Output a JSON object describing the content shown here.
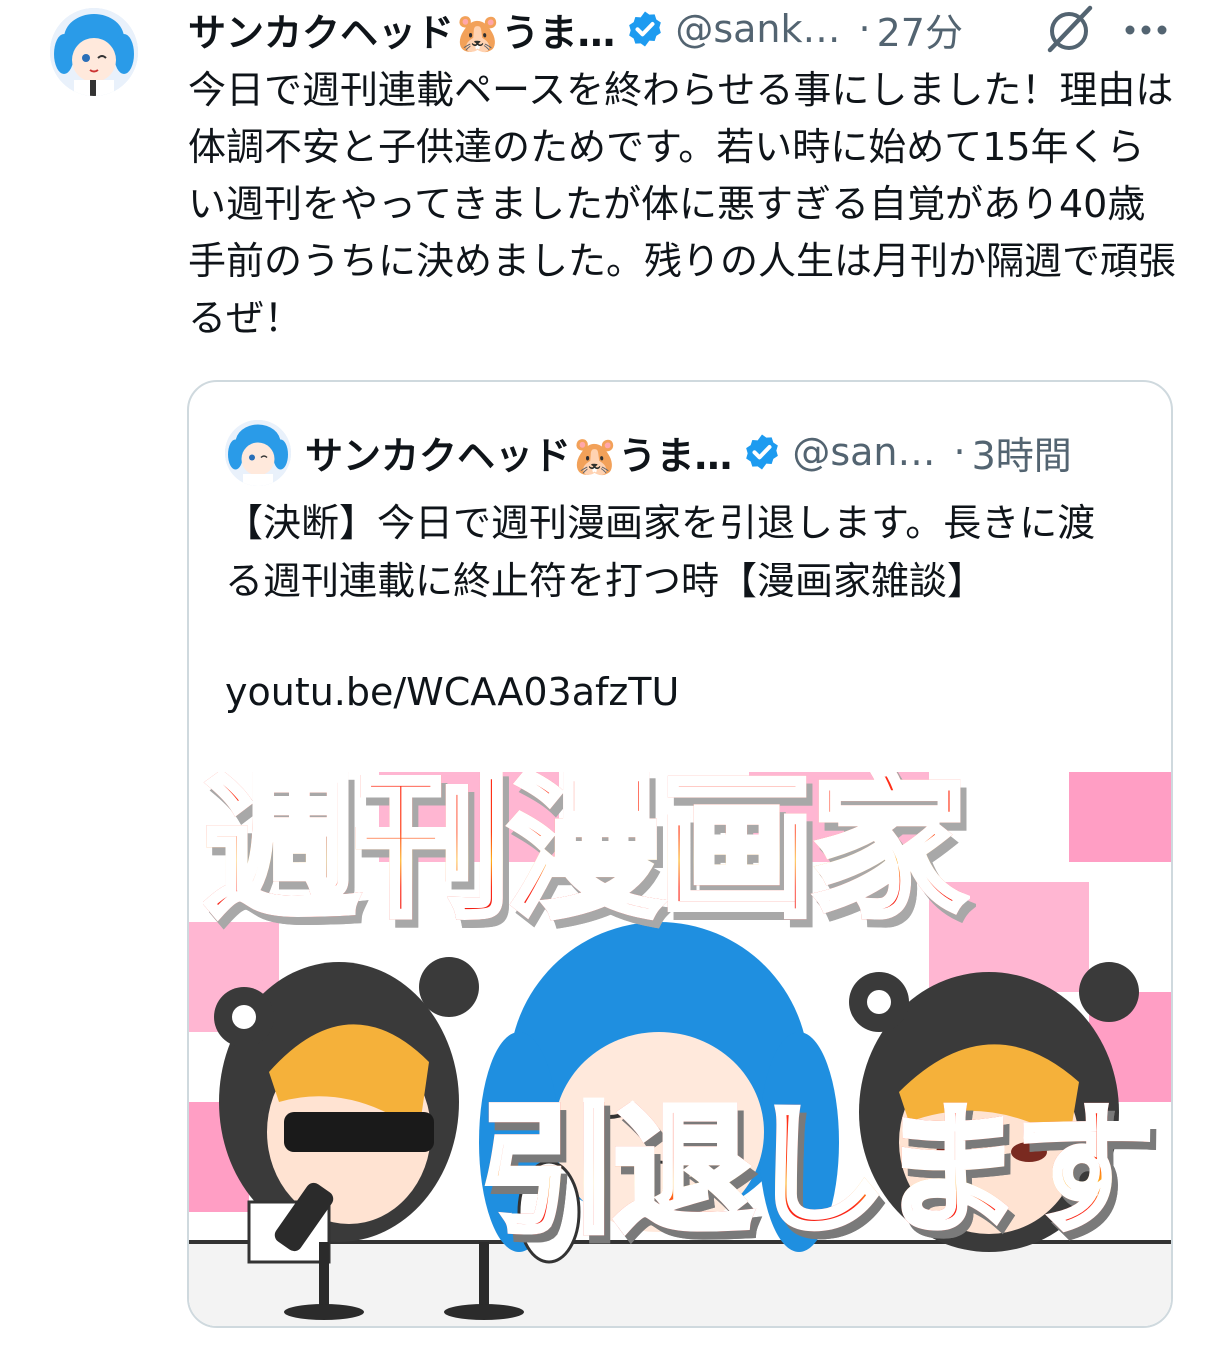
{
  "tweet": {
    "author_name": "サンカクヘッド🐹うま…",
    "handle": "@sank…",
    "separator": "·",
    "time": "27分",
    "text": "今日で週刊連載ペースを終わらせる事にしました！理由は体調不安と子供達のためです。若い時に始めて15年くらい週刊をやってきましたが体に悪すぎる自覚があり40歳手前のうちに決めました。残りの人生は月刊か隔週で頑張るぜ！"
  },
  "quote": {
    "author_name": "サンカクヘッド🐹うま…",
    "handle": "@san…",
    "separator": "·",
    "time": "3時間",
    "text": "【決断】今日で週刊漫画家を引退します。長きに渡る週刊連載に終止符を打つ時【漫画家雑談】",
    "link": "youtu.be/WCAA03afzTU",
    "thumbnail": {
      "title_top": "週刊漫画家",
      "title_bottom": "引退します"
    }
  },
  "icons": [
    "verified-badge-icon",
    "grok-icon",
    "more-icon"
  ],
  "colors": {
    "verified": "#1d9bf0",
    "secondary_text": "#536471",
    "border": "#cfd9de"
  }
}
